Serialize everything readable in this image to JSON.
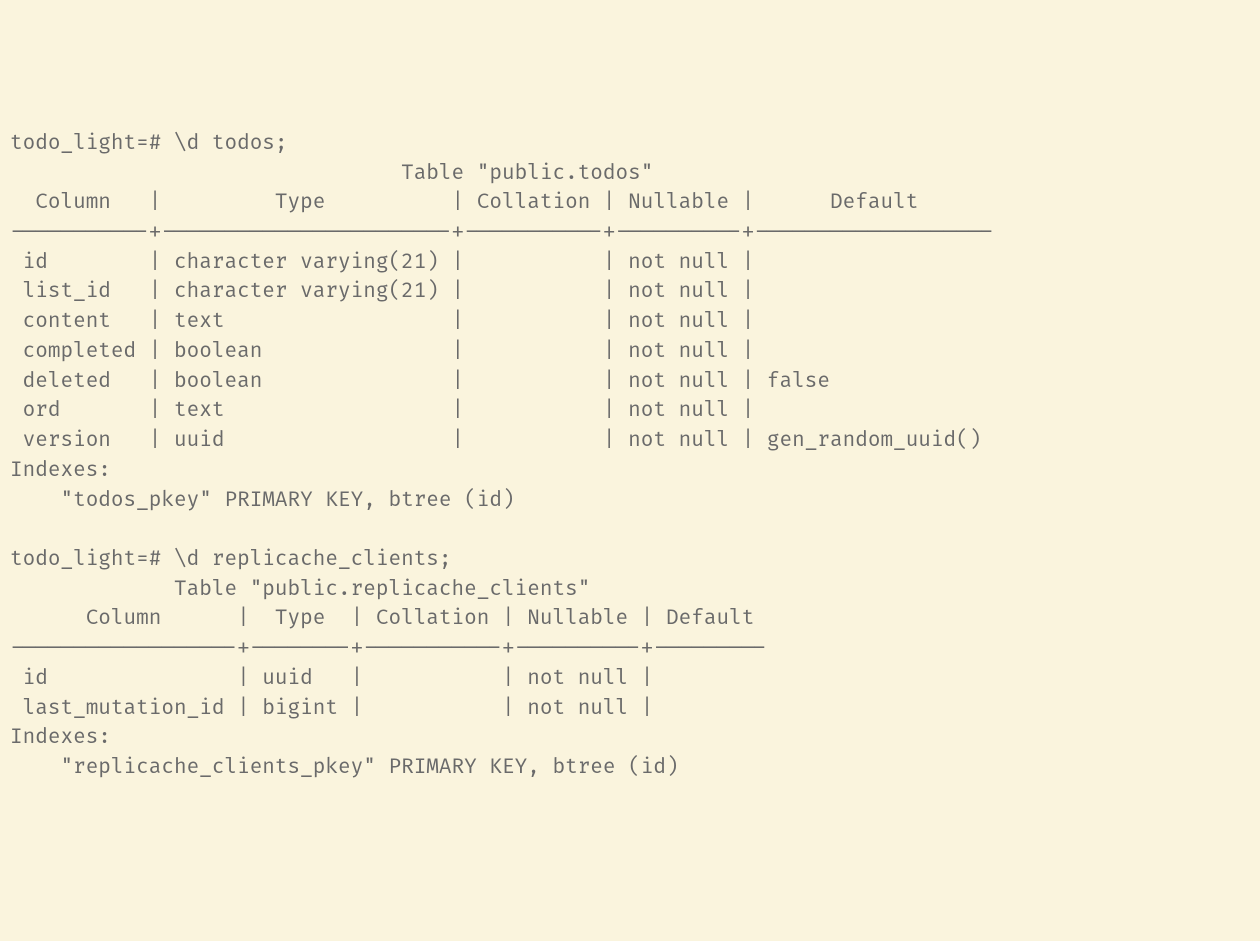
{
  "terminal": {
    "prompt1": "todo_light=# \\d todos;",
    "table1_title": "                               Table \"public.todos\"",
    "table1_header": "  Column   |         Type          | Collation | Nullable |      Default",
    "table1_divider": "-----------+-----------------------+-----------+----------+-------------------",
    "table1_rows": {
      "r0": " id        | character varying(21) |           | not null |",
      "r1": " list_id   | character varying(21) |           | not null |",
      "r2": " content   | text                  |           | not null |",
      "r3": " completed | boolean               |           | not null |",
      "r4": " deleted   | boolean               |           | not null | false",
      "r5": " ord       | text                  |           | not null |",
      "r6": " version   | uuid                  |           | not null | gen_random_uuid()"
    },
    "table1_indexes_label": "Indexes:",
    "table1_indexes_line": "    \"todos_pkey\" PRIMARY KEY, btree (id)",
    "blank_line": "",
    "prompt2": "todo_light=# \\d replicache_clients;",
    "table2_title": "             Table \"public.replicache_clients\"",
    "table2_header": "      Column      |  Type  | Collation | Nullable | Default",
    "table2_divider": "------------------+--------+-----------+----------+---------",
    "table2_rows": {
      "r0": " id               | uuid   |           | not null |",
      "r1": " last_mutation_id | bigint |           | not null |"
    },
    "table2_indexes_label": "Indexes:",
    "table2_indexes_line": "    \"replicache_clients_pkey\" PRIMARY KEY, btree (id)"
  }
}
